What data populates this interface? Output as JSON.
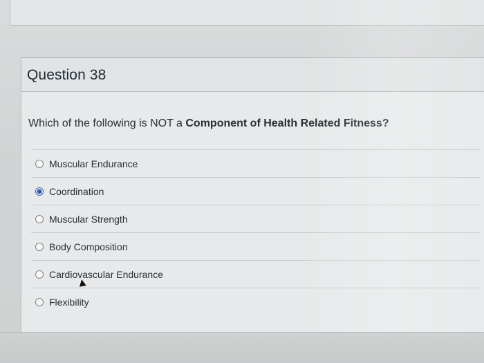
{
  "question": {
    "title": "Question 38",
    "text_prefix": "Which of the following is NOT a ",
    "text_bold": "Component of Health Related Fitness?"
  },
  "answers": [
    {
      "label": "Muscular Endurance",
      "selected": false
    },
    {
      "label": "Coordination",
      "selected": true
    },
    {
      "label": "Muscular Strength",
      "selected": false
    },
    {
      "label": "Body Composition",
      "selected": false
    },
    {
      "label": "Cardiovascular Endurance",
      "selected": false
    },
    {
      "label": "Flexibility",
      "selected": false
    }
  ],
  "colors": {
    "selected_radio": "#2f5ca8"
  },
  "icons": {
    "left_arrow": "chevron-right-icon",
    "cursor": "mouse-cursor-icon"
  }
}
